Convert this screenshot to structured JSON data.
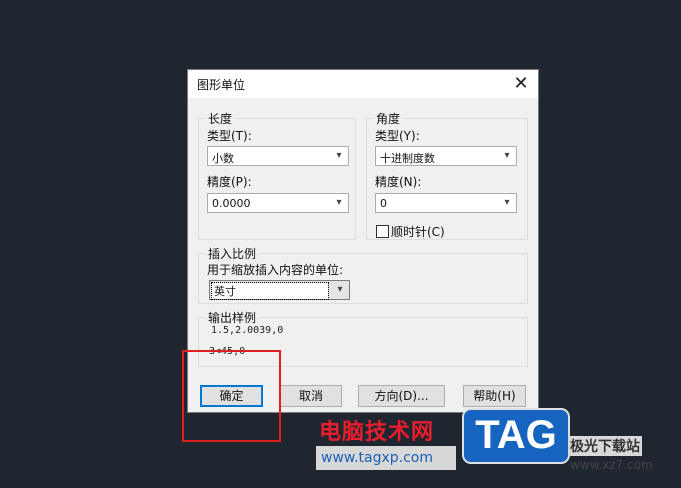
{
  "dialog": {
    "title": "图形单位",
    "close_symbol": "✕"
  },
  "length": {
    "group_title": "长度",
    "type_label": "类型(T):",
    "type_value": "小数",
    "precision_label": "精度(P):",
    "precision_value": "0.0000"
  },
  "angle": {
    "group_title": "角度",
    "type_label": "类型(Y):",
    "type_value": "十进制度数",
    "precision_label": "精度(N):",
    "precision_value": "0",
    "clockwise_label": "顺时针(C)",
    "clockwise_checked": false
  },
  "insert_scale": {
    "group_title": "插入比例",
    "units_label": "用于缩放插入内容的单位:",
    "units_value": "英寸"
  },
  "output_sample": {
    "group_title": "输出样例",
    "line1": "1.5,2.0039,0",
    "line2": "3<45,0"
  },
  "buttons": {
    "ok": "确定",
    "cancel": "取消",
    "direction": "方向(D)...",
    "help": "帮助(H)"
  },
  "icons": {
    "dropdown": "▾"
  },
  "watermark": {
    "site_name": "电脑技术网",
    "url": "www.tagxp.com",
    "logo": "TAG",
    "side_text": "极光下载站",
    "side_url": "www.xz7.com"
  },
  "colors": {
    "highlight_box": "#e02020",
    "default_button_border": "#0078d7"
  }
}
